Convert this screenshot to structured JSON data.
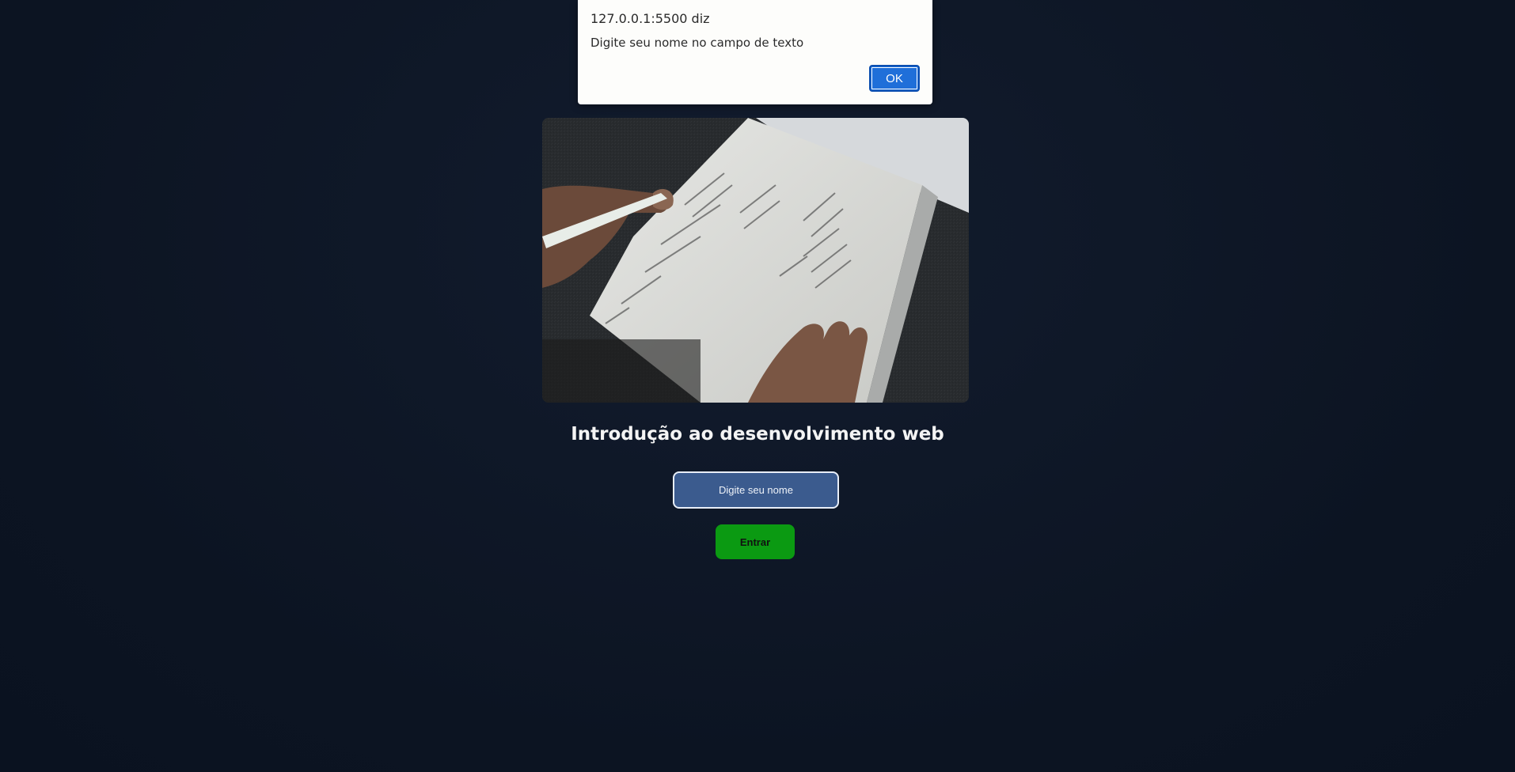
{
  "alert": {
    "origin": "127.0.0.1:5500 diz",
    "message": "Digite seu nome no campo de texto",
    "ok_label": "OK"
  },
  "hero": {
    "image_description": "hands-writing-on-journal-page-icon"
  },
  "main": {
    "title": "Introdução ao desenvolvimento web",
    "name_input_placeholder": "Digite seu nome",
    "name_input_value": "",
    "enter_label": "Entrar"
  },
  "colors": {
    "background": "#0e1626",
    "input_bg": "#3b5b8e",
    "button_bg": "#0b9a12",
    "ok_button": "#1f6fd9"
  }
}
